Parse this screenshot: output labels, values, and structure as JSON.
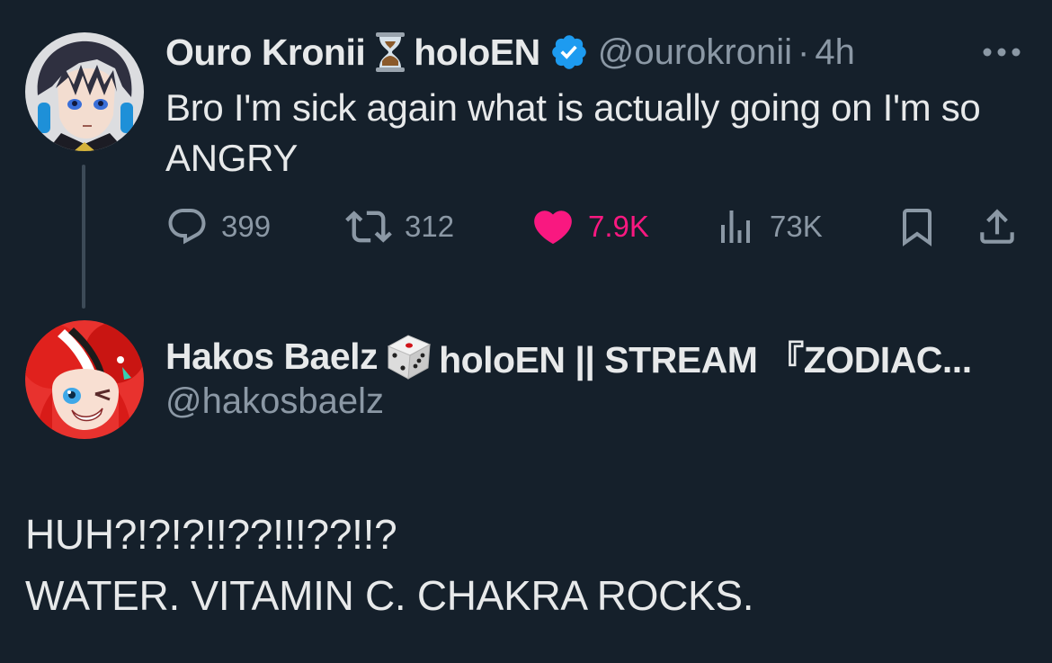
{
  "tweet": {
    "author": {
      "display_name": "Ouro Kronii",
      "badge_text": "holoEN",
      "handle": "@ourokronii",
      "separator": "·",
      "time": "4h",
      "emoji_icon": "hourglass-icon",
      "verified_icon": "verified-badge-icon"
    },
    "text": "Bro I'm sick again what is actually going on I'm so ANGRY",
    "actions": {
      "replies": "399",
      "reposts": "312",
      "likes": "7.9K",
      "views": "73K"
    },
    "colors": {
      "like_active": "#f91880",
      "verified": "#1d9bf0",
      "muted": "#8b98a5",
      "text": "#e7e9ea",
      "background": "#15202b"
    }
  },
  "reply": {
    "author": {
      "display_name": "Hakos Baelz",
      "badge_text": "holoEN || STREAM 『ZODIAC...",
      "handle": "@hakosbaelz",
      "emoji_icon": "dice-icon"
    },
    "lines": [
      "HUH?!?!?!!??!!!??!!?",
      "WATER. VITAMIN C. CHAKRA ROCKS."
    ]
  }
}
